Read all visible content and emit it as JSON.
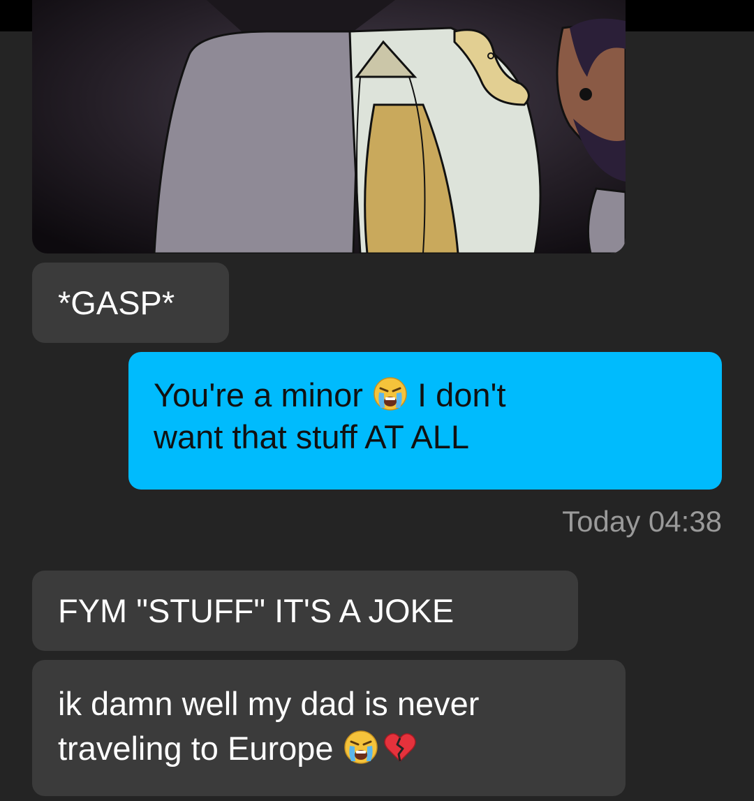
{
  "thread": {
    "messages": [
      {
        "direction": "incoming",
        "type": "image"
      },
      {
        "direction": "incoming",
        "text": "*GASP*"
      },
      {
        "direction": "outgoing",
        "line1_a": "You're a minor",
        "emoji1": "loudly-crying-face",
        "line1_b": "I don't",
        "line2": "want that stuff AT ALL"
      },
      {
        "direction": "incoming",
        "text": "FYM \"STUFF\" IT'S A JOKE"
      },
      {
        "direction": "incoming",
        "line1": "ik damn well my dad is never",
        "line2_a": "traveling to Europe",
        "emoji1": "loudly-crying-face",
        "emoji2": "broken-heart"
      }
    ],
    "timestamp": "Today 04:38"
  },
  "colors": {
    "background": "#242424",
    "incoming_bubble": "#3b3b3b",
    "outgoing_bubble": "#00bbfd",
    "timestamp_text": "#9a9a9a"
  }
}
